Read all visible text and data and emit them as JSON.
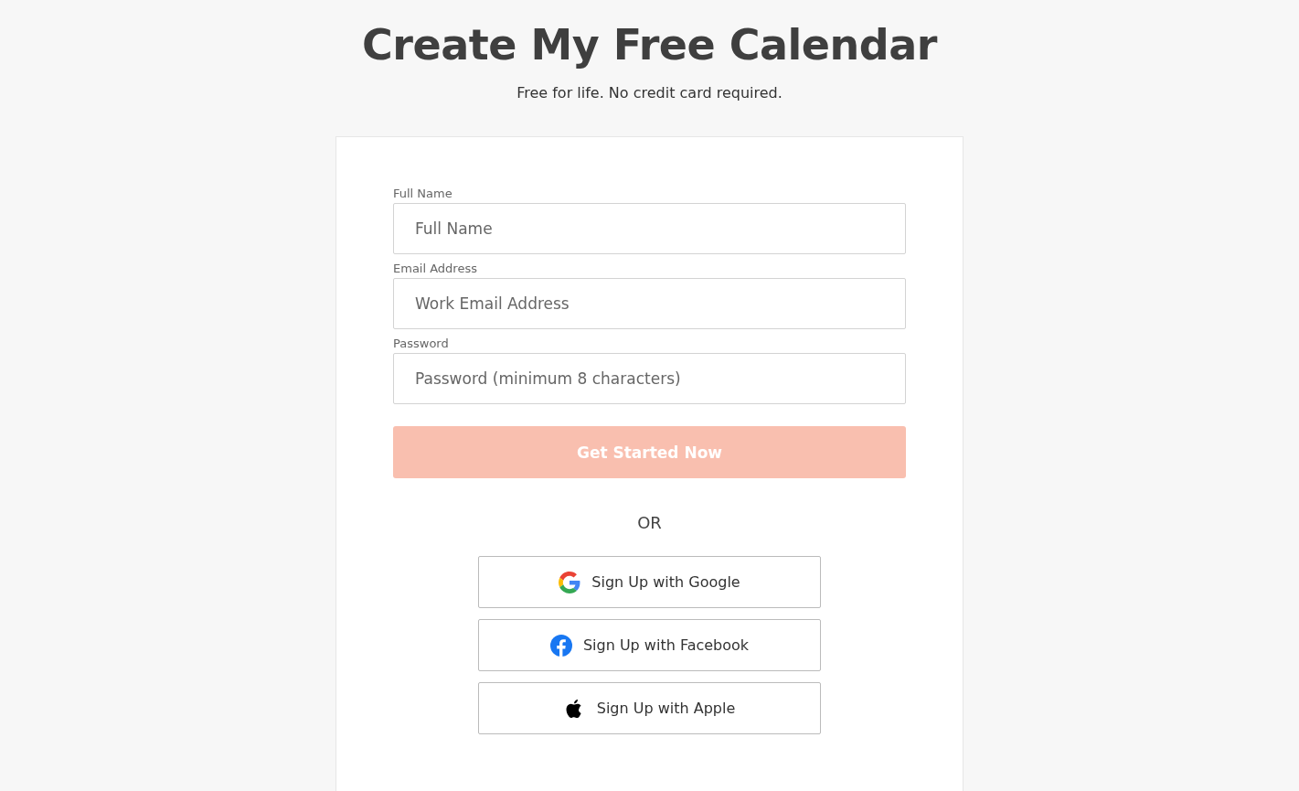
{
  "header": {
    "title": "Create My Free Calendar",
    "subtitle": "Free for life. No credit card required."
  },
  "fields": [
    {
      "label": "Full Name",
      "placeholder": "Full Name"
    },
    {
      "label": "Email Address",
      "placeholder": "Work Email Address"
    },
    {
      "label": "Password",
      "placeholder": "Password (minimum 8 characters)"
    }
  ],
  "submit": {
    "label": "Get Started Now",
    "disabled": true
  },
  "divider": "OR",
  "social_buttons": [
    {
      "kind": "google",
      "label": "Sign Up with Google"
    },
    {
      "kind": "facebook",
      "label": "Sign Up with Facebook"
    },
    {
      "kind": "apple",
      "label": "Sign Up with Apple"
    }
  ]
}
